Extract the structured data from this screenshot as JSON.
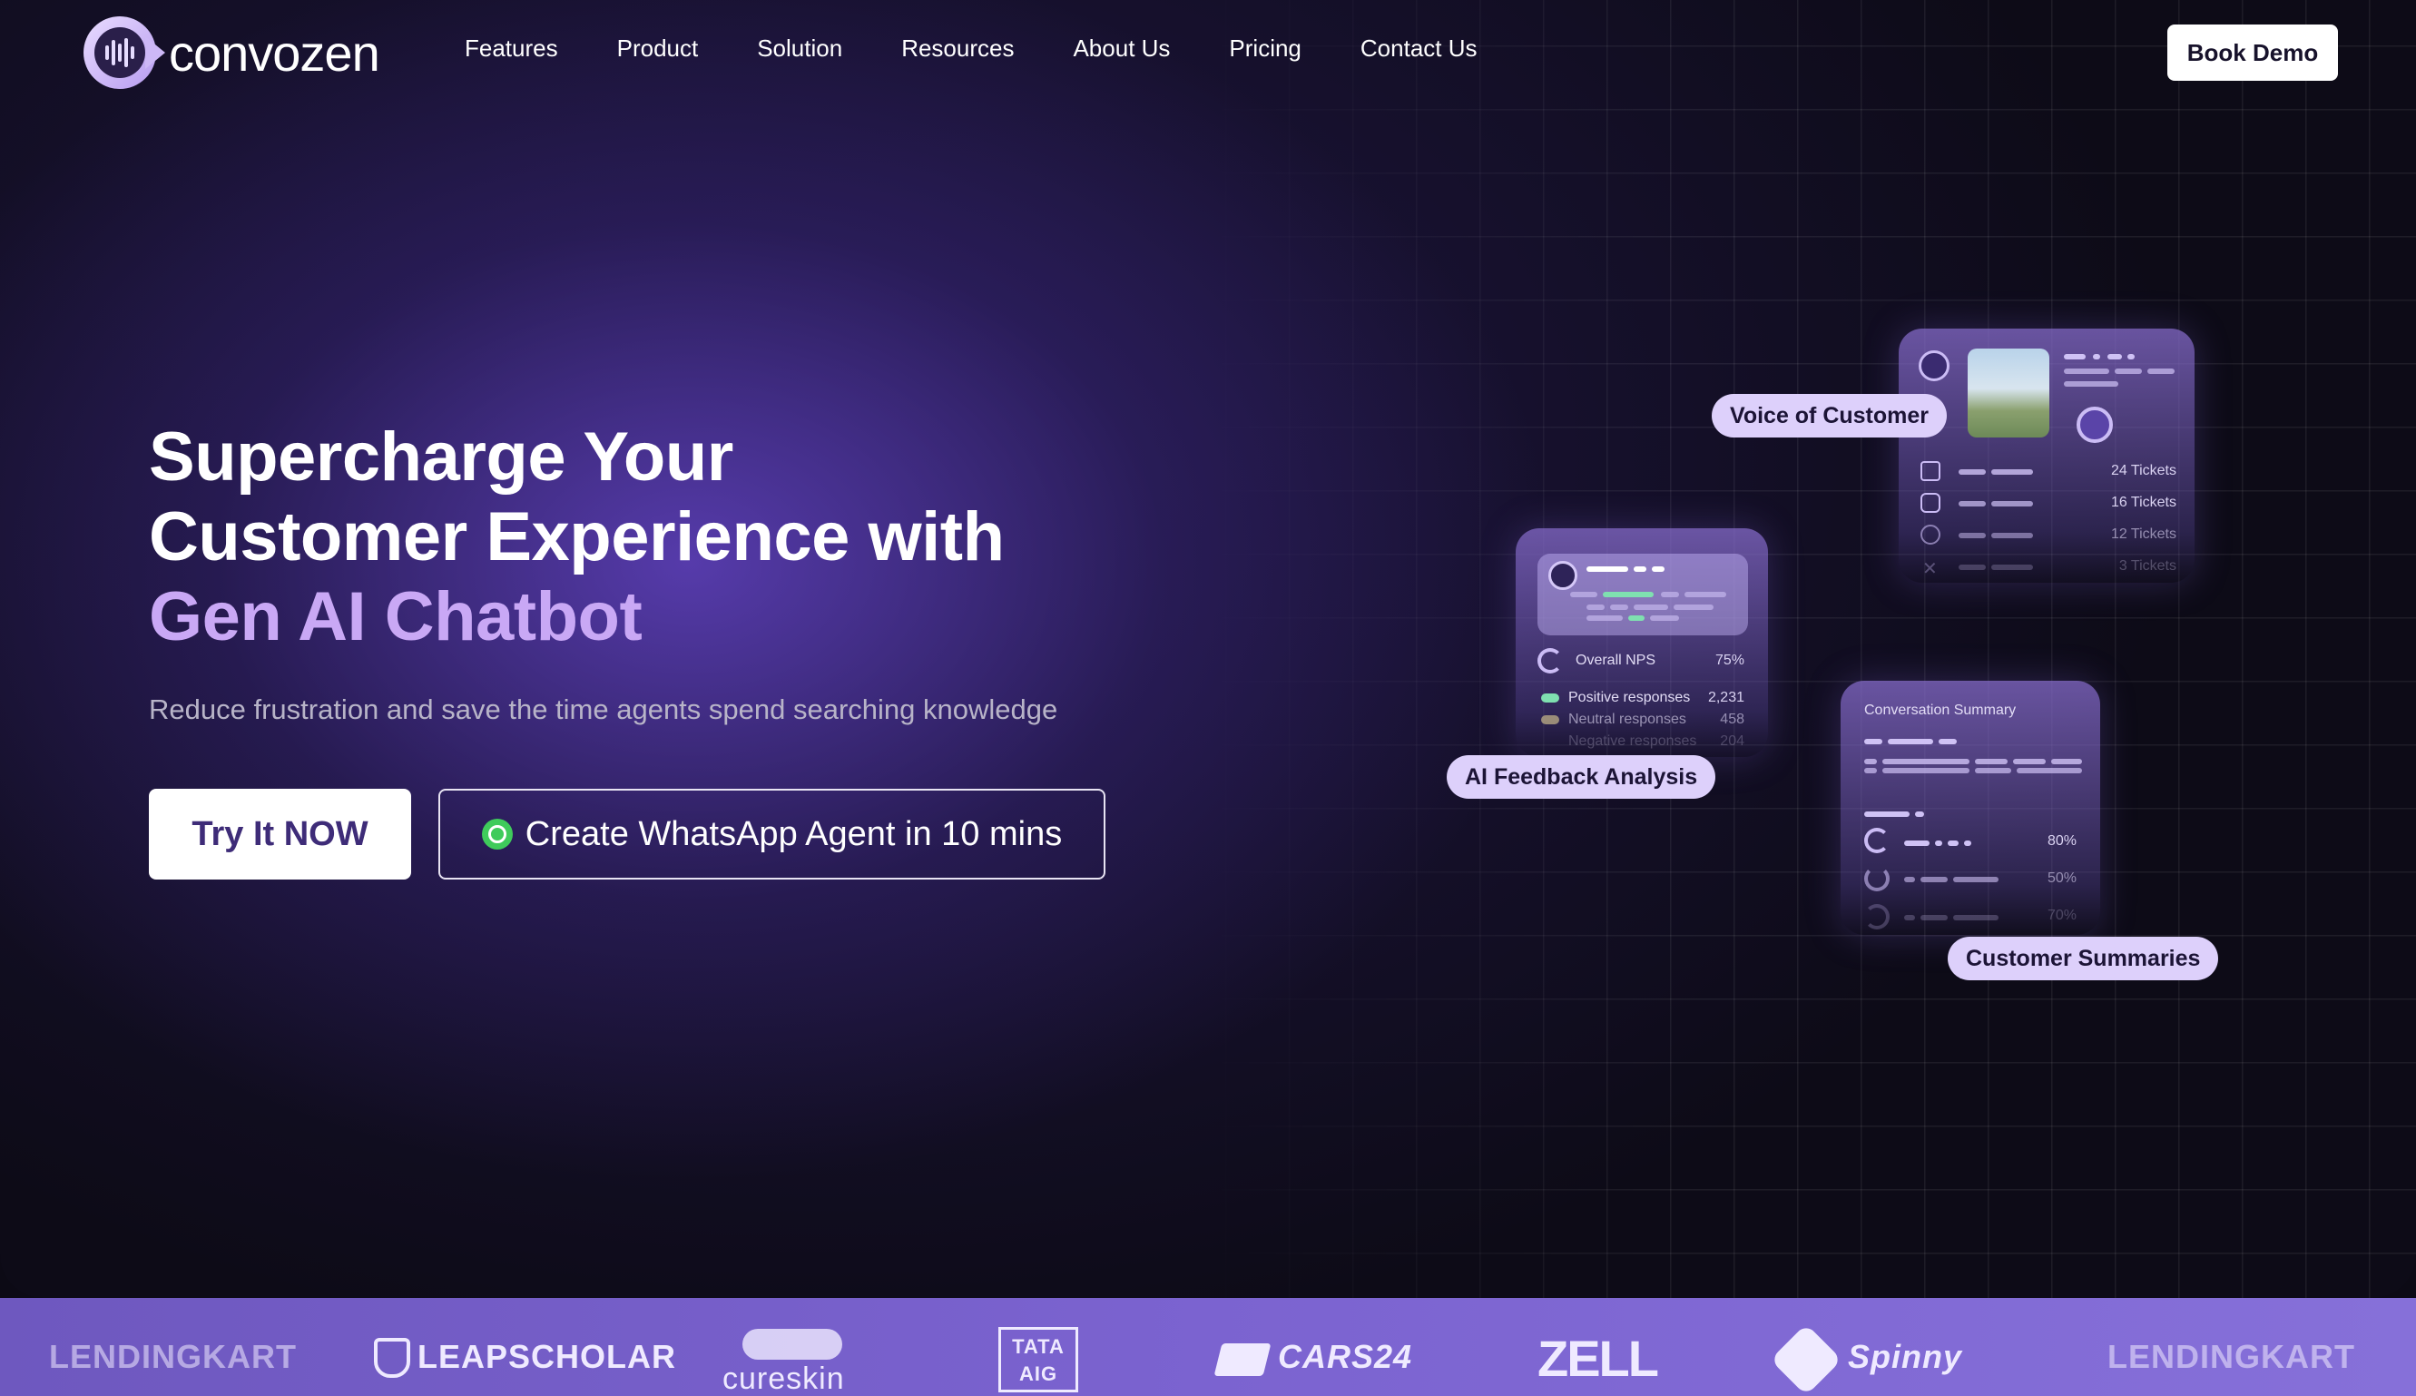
{
  "header": {
    "logo_text": "convozen",
    "nav": [
      "Features",
      "Product",
      "Solution",
      "Resources",
      "About Us",
      "Pricing",
      "Contact Us"
    ],
    "cta": "Book Demo"
  },
  "hero": {
    "title_line1": "Supercharge Your",
    "title_line2": "Customer Experience with",
    "title_accent": "Gen AI Chatbot",
    "subtitle": "Reduce frustration and save the time agents spend searching knowledge",
    "primary_button": "Try It NOW",
    "secondary_button": "Create WhatsApp Agent in 10 mins"
  },
  "cards": {
    "voice": {
      "label": "Voice of Customer",
      "rows": [
        "24 Tickets",
        "16 Tickets",
        "12 Tickets",
        "3 Tickets"
      ]
    },
    "feedback": {
      "label": "AI Feedback Analysis",
      "nps_label": "Overall NPS",
      "nps_value": "75%",
      "rows": [
        {
          "label": "Positive responses",
          "value": "2,231"
        },
        {
          "label": "Neutral responses",
          "value": "458"
        },
        {
          "label": "Negative responses",
          "value": "204"
        }
      ]
    },
    "summary": {
      "label": "Customer Summaries",
      "title": "Conversation Summary",
      "rows": [
        "80%",
        "50%",
        "70%"
      ]
    }
  },
  "brands": [
    "LENDINGKART",
    "LEAPSCHOLAR",
    "cureskin",
    "TATA AIG",
    "CARS24",
    "ZELL",
    "Spinny",
    "LENDINGKART"
  ],
  "colors": {
    "accent": "#c9a8f5",
    "pill": "#ddd0fb",
    "strip": "#7b63d0",
    "whatsapp": "#3fcb5b"
  }
}
